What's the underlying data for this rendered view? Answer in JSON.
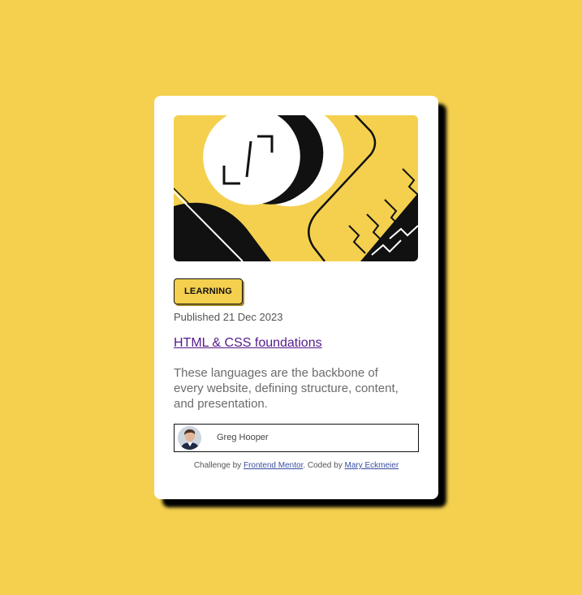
{
  "card": {
    "category": "Learning",
    "published": "Published 21 Dec 2023",
    "title": "HTML & CSS foundations",
    "description": "These languages are the backbone of every website, defining structure, content, and presentation."
  },
  "author": {
    "name": "Greg Hooper"
  },
  "attribution": {
    "prefix": "Challenge by",
    "link1": "Frontend Mentor",
    "middle": ". Coded by",
    "link2": "Mary Eckmeier"
  },
  "colors": {
    "background": "#f4d04e",
    "card": "#ffffff",
    "shadow": "#000000",
    "title_link": "#551a8b",
    "attribution_link": "#3a4ea0"
  },
  "icons": {
    "hero": "illustration-article",
    "avatar": "author-avatar"
  }
}
